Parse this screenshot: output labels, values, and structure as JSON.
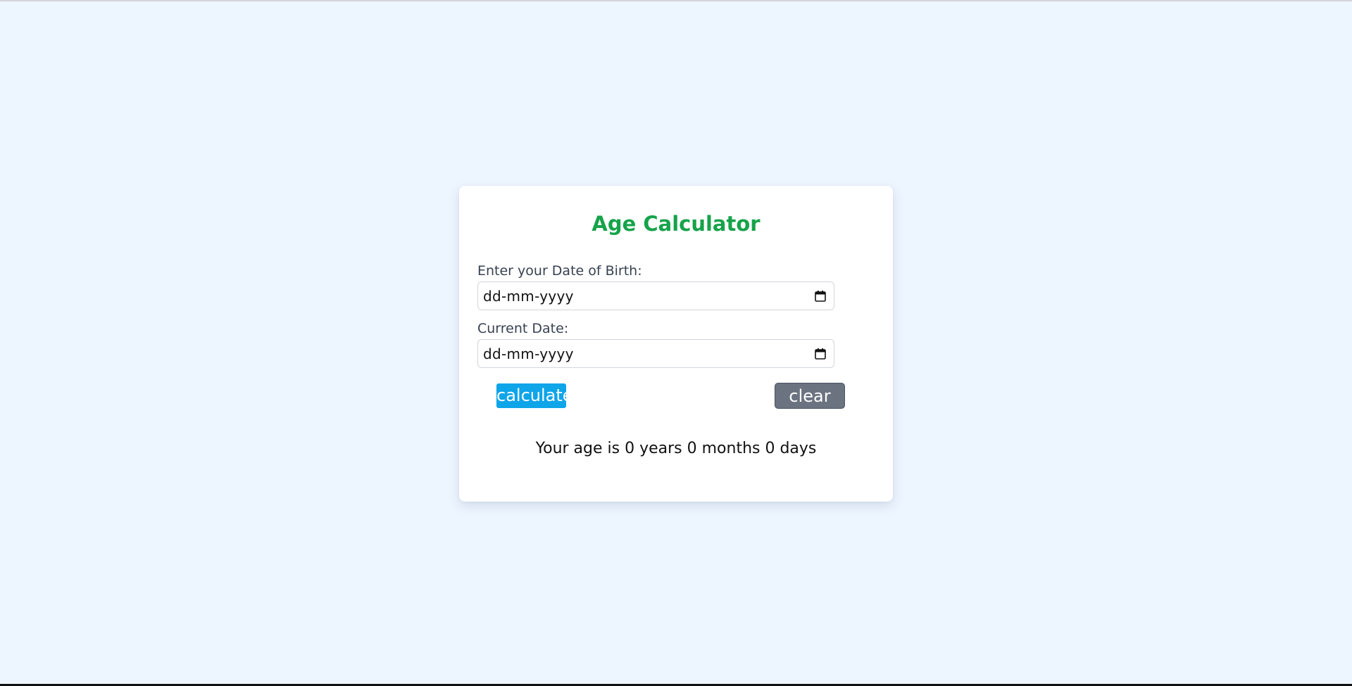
{
  "app": {
    "title": "Age Calculator"
  },
  "form": {
    "dob_label": "Enter your Date of Birth:",
    "dob_placeholder": "dd-mm-yyyy",
    "current_label": "Current Date:",
    "current_placeholder": "dd-mm-yyyy",
    "dob_icon": "calendar-icon",
    "current_icon": "calendar-icon"
  },
  "buttons": {
    "calculate_label": "calculate",
    "clear_label": "clear"
  },
  "result": {
    "text": "Your age is 0 years 0 months 0 days"
  },
  "colors": {
    "page_background": "#edf5ff",
    "title": "#16a34a",
    "calculate_button": "#0ea5e9",
    "clear_button": "#6b7280"
  }
}
